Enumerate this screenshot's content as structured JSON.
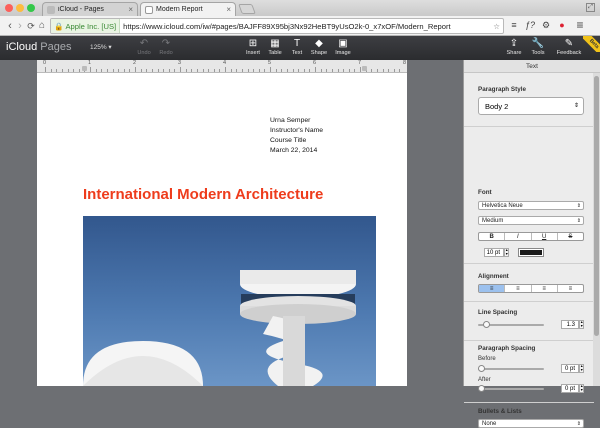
{
  "browser": {
    "tabs": [
      {
        "title": "iCloud - Pages",
        "active": false
      },
      {
        "title": "Modern Report",
        "active": true
      }
    ],
    "nav": {
      "back": "‹",
      "forward": "›",
      "reload": "⟳",
      "home": "⌂"
    },
    "address": {
      "ev_label": "Apple Inc. [US]",
      "url": "https://www.icloud.com/iw/#pages/BAJFF89X95bj3Nx92HeBT9yUsO2k-0_x7xOF/Modern_Report"
    },
    "extensions": [
      "☆",
      "≡",
      "ƒ?",
      "⚙",
      "●",
      "≡"
    ]
  },
  "app": {
    "logo_main": "iCloud",
    "logo_sub": "Pages",
    "zoom": "125% ▾",
    "toolbar": {
      "undo": "Undo",
      "redo": "Redo",
      "insert": "Insert",
      "table": "Table",
      "text": "Text",
      "shape": "Shape",
      "image": "Image",
      "share": "Share",
      "tools": "Tools",
      "feedback": "Feedback"
    },
    "beta": "Beta"
  },
  "ruler": {
    "numbers": [
      "0",
      "1",
      "2",
      "3",
      "4",
      "5",
      "6",
      "7",
      "8"
    ]
  },
  "document": {
    "meta_lines": [
      "Urna Semper",
      "Instructor's Name",
      "Course Title",
      "March 22, 2014"
    ],
    "title": "International Modern Architecture"
  },
  "inspector": {
    "header": "Text",
    "paragraph_style": {
      "label": "Paragraph Style",
      "value": "Body 2"
    },
    "font": {
      "label": "Font",
      "family": "Helvetica Neue",
      "weight": "Medium",
      "bold": "B",
      "italic": "I",
      "underline": "U",
      "strike": "S",
      "size": "10 pt",
      "color": "#1a1a1a"
    },
    "alignment": {
      "label": "Alignment",
      "options": [
        "≡",
        "≡",
        "≡",
        "≡"
      ],
      "selected_index": 0
    },
    "line_spacing": {
      "label": "Line Spacing",
      "value": "1.3",
      "level": 0.08
    },
    "paragraph_spacing": {
      "label": "Paragraph Spacing",
      "before_label": "Before",
      "before_value": "0 pt",
      "before_level": 0,
      "after_label": "After",
      "after_value": "0 pt",
      "after_level": 0
    },
    "bullets": {
      "label": "Bullets & Lists",
      "value": "None"
    }
  },
  "colors": {
    "title_red": "#ee3c1c",
    "selected": "#9cc1ee",
    "toolbar": "#2f3034"
  }
}
